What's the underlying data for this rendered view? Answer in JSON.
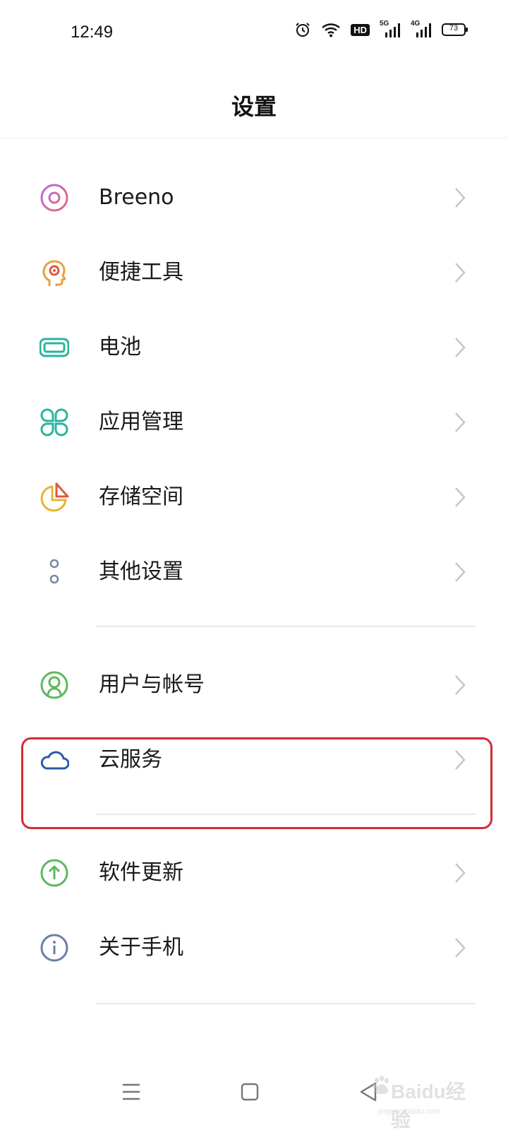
{
  "status_bar": {
    "time": "12:49",
    "network_5g": "5G",
    "network_4g": "4G",
    "hd_badge": "HD",
    "battery_level": "73",
    "icons": [
      "alarm-icon",
      "wifi-icon",
      "hd-icon",
      "signal-5g-icon",
      "signal-4g-icon",
      "battery-icon"
    ]
  },
  "header": {
    "title": "设置"
  },
  "settings": {
    "items": [
      {
        "label": "Breeno",
        "icon": "breeno-icon",
        "color": "#d467c4"
      },
      {
        "label": "便捷工具",
        "icon": "convenience-tools-icon",
        "color": "#e8a23a"
      },
      {
        "label": "电池",
        "icon": "battery-settings-icon",
        "color": "#2bb3a0"
      },
      {
        "label": "应用管理",
        "icon": "app-management-icon",
        "color": "#2bb3a0"
      },
      {
        "label": "存储空间",
        "icon": "storage-icon",
        "color": "#e8b42e"
      },
      {
        "label": "其他设置",
        "icon": "other-settings-icon",
        "color": "#7a8aa6"
      },
      {
        "label": "用户与帐号",
        "icon": "user-account-icon",
        "color": "#5cb85c"
      },
      {
        "label": "云服务",
        "icon": "cloud-service-icon",
        "color": "#2e5aa8"
      },
      {
        "label": "软件更新",
        "icon": "software-update-icon",
        "color": "#5cb85c"
      },
      {
        "label": "关于手机",
        "icon": "about-phone-icon",
        "color": "#6a7fa8"
      }
    ]
  },
  "highlight": {
    "color": "#d62b35",
    "target": "云服务"
  },
  "nav_bar": {
    "icons": [
      "menu-icon",
      "home-icon",
      "back-icon"
    ]
  },
  "watermark": {
    "brand": "Baidu经验",
    "url": "jingyan.baidu.com"
  }
}
